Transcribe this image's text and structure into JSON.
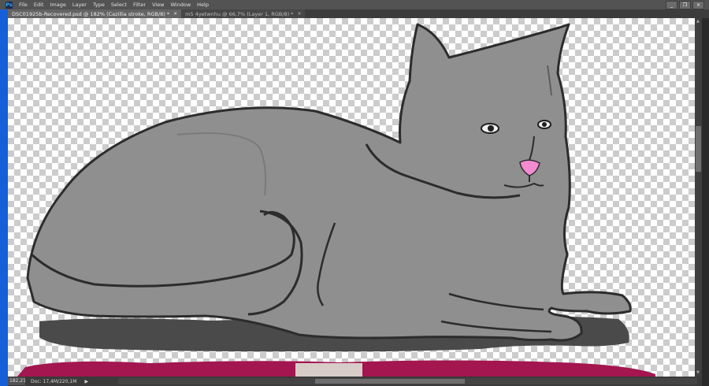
{
  "app": {
    "logo_text": "Ps"
  },
  "menu": [
    "File",
    "Edit",
    "Image",
    "Layer",
    "Type",
    "Select",
    "Filter",
    "View",
    "Window",
    "Help"
  ],
  "window_controls": {
    "minimize": "_",
    "restore": "❐",
    "close": "×"
  },
  "tabs": [
    {
      "label": "DSC01925b-Recovered.psd @ 182% (Cazillia stroke, RGB/8) *",
      "active": true,
      "close": "×"
    },
    {
      "label": "m5 4yetwnhu @ 66,7% (Layer 1, RGB/8) *",
      "active": false,
      "close": "×"
    }
  ],
  "status": {
    "zoom": "182,21",
    "doc_info": "Doc: 17,4M/220,1M",
    "menu_arrow": "▶"
  },
  "colors": {
    "cat_fill": "#8f8f8f",
    "outline": "#2c2c2c",
    "cushion": "#4a4a4a",
    "pillow": "#a3164f",
    "nose": "#f48bd1",
    "selection_blue": "#1560d8"
  }
}
